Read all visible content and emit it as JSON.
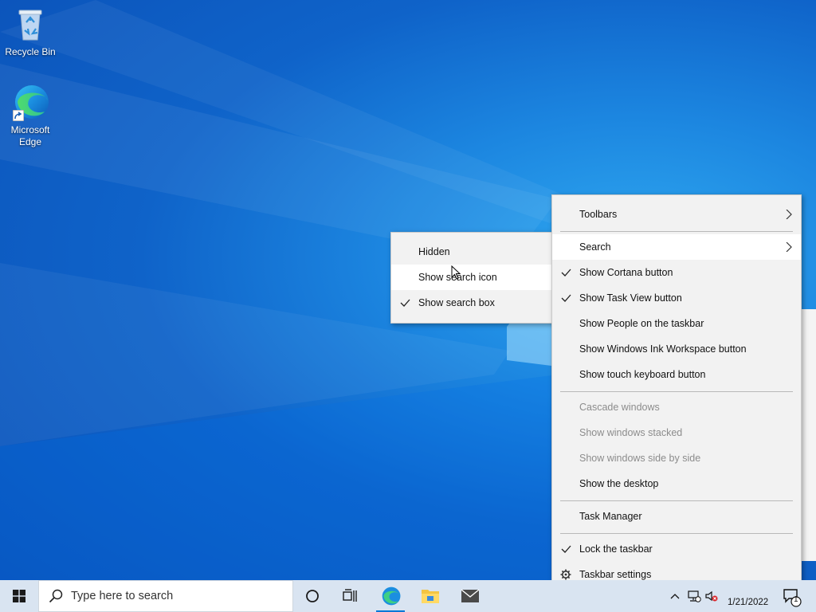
{
  "desktop": {
    "icons": [
      {
        "label": "Recycle Bin"
      },
      {
        "label_line1": "Microsoft",
        "label_line2": "Edge"
      }
    ]
  },
  "main_menu": {
    "items": [
      {
        "label": "Toolbars",
        "submenu": true
      },
      {
        "label": "Search",
        "submenu": true,
        "highlighted": true
      },
      {
        "label": "Show Cortana button",
        "checked": true
      },
      {
        "label": "Show Task View button",
        "checked": true
      },
      {
        "label": "Show People on the taskbar"
      },
      {
        "label": "Show Windows Ink Workspace button"
      },
      {
        "label": "Show touch keyboard button"
      },
      {
        "label": "Cascade windows",
        "disabled": true
      },
      {
        "label": "Show windows stacked",
        "disabled": true
      },
      {
        "label": "Show windows side by side",
        "disabled": true
      },
      {
        "label": "Show the desktop"
      },
      {
        "label": "Task Manager"
      },
      {
        "label": "Lock the taskbar",
        "checked": true
      },
      {
        "label": "Taskbar settings",
        "icon": "gear-icon"
      }
    ]
  },
  "search_submenu": {
    "items": [
      {
        "label": "Hidden"
      },
      {
        "label": "Show search icon",
        "highlighted": true
      },
      {
        "label": "Show search box",
        "checked": true
      }
    ]
  },
  "taskbar": {
    "search_placeholder": "Type here to search",
    "pinned": [
      "cortana-icon",
      "task-view-icon",
      "edge-icon",
      "file-explorer-icon",
      "mail-icon"
    ],
    "date": "1/21/2022",
    "notification_count": "1"
  },
  "colors": {
    "accent": "#0078d7",
    "menu_bg": "#f2f2f2",
    "taskbar_bg": "#d9e4f1"
  }
}
